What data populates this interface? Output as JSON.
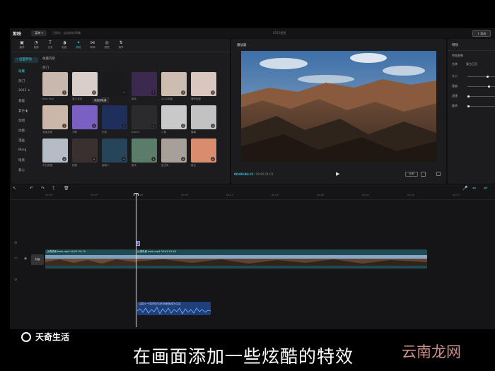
{
  "titlebar": {
    "app_name": "剪映",
    "menu": "菜单 ▾",
    "autosave": "已保存 · 自动保存草稿",
    "project_name": "0521视频",
    "export": "⇪ 导出"
  },
  "toolbar": [
    {
      "label": "媒体",
      "icon": "media-icon"
    },
    {
      "label": "音频",
      "icon": "audio-icon"
    },
    {
      "label": "文本",
      "icon": "text-icon"
    },
    {
      "label": "贴纸",
      "icon": "sticker-icon"
    },
    {
      "label": "特效",
      "icon": "effect-icon",
      "active": true
    },
    {
      "label": "转场",
      "icon": "transition-icon"
    },
    {
      "label": "滤镜",
      "icon": "filter-icon"
    },
    {
      "label": "调节",
      "icon": "adjust-icon"
    }
  ],
  "categories": [
    {
      "label": "• 画面特效",
      "first": true
    },
    {
      "label": "收藏",
      "active": true
    },
    {
      "label": "热门"
    },
    {
      "label": "2022 ✦"
    },
    {
      "label": "基础"
    },
    {
      "label": "复古 ▮"
    },
    {
      "label": "氛围"
    },
    {
      "label": "动感"
    },
    {
      "label": "漫画"
    },
    {
      "label": "Bling"
    },
    {
      "label": "暗黑"
    },
    {
      "label": "爱心"
    }
  ],
  "section_titles": {
    "favorites": "收藏内容",
    "hot": "热门"
  },
  "tooltip": "添加到轨道",
  "effects": [
    {
      "label": "New Year",
      "bg": "#c9b8ad"
    },
    {
      "label": "爱心泡泡",
      "bg": "#d9cfc8"
    },
    {
      "label": "变秋日",
      "bg": "#1a1a1c"
    },
    {
      "label": "新年",
      "bg": "#3c2a4e"
    },
    {
      "label": "2022祝福",
      "bg": "#cdbdb0"
    },
    {
      "label": "爆炸抱抱",
      "bg": "#d9c6bf"
    },
    {
      "label": "漫画恋爱",
      "bg": "#cbb7a9"
    },
    {
      "label": "冲刺",
      "bg": "#7b60c4"
    },
    {
      "label": "闪电",
      "bg": "#1d2f5a"
    },
    {
      "label": "DISCO",
      "bg": "#2b2b2e"
    },
    {
      "label": "人像",
      "bg": "#c9c9c9"
    },
    {
      "label": "模糊",
      "bg": "#c2c2c2"
    },
    {
      "label": "冬日氛围",
      "bg": "#b6bcc6"
    },
    {
      "label": "相框",
      "bg": "#3b3030"
    },
    {
      "label": "鱼眼 II",
      "bg": "#27455a"
    },
    {
      "label": "雾天",
      "bg": "#5c7c6a"
    },
    {
      "label": "复古风",
      "bg": "#a6a098"
    },
    {
      "label": "星空",
      "bg": "#d98c6e"
    }
  ],
  "player": {
    "title": "播放器",
    "time_current": "00:00:06:15",
    "time_total": "00:00:21:01",
    "play": "▶",
    "ratio": "比例"
  },
  "properties": {
    "title": "特效",
    "section": "特效参数",
    "rows": [
      {
        "label": "名称",
        "value": "复古日月"
      },
      {
        "label": "大小",
        "level": 0.7
      },
      {
        "label": "速度",
        "level": 0.75
      },
      {
        "label": "滤镜",
        "level": 0.0
      },
      {
        "label": "旋转",
        "level": 0.0
      }
    ]
  },
  "timeline": {
    "tools": [
      "↖",
      "↶",
      "↷",
      "⌶",
      "🗑"
    ],
    "ticks": [
      "00:00",
      "00:03",
      "00:06",
      "00:09",
      "00:12",
      "00:15",
      "00:18",
      "00:21",
      "00:24",
      "00:27"
    ],
    "cover": "封面",
    "marker": "复",
    "clips": [
      {
        "title": "沙漠风景 back.mp4   00:01:20:15",
        "color": "#1e4c52"
      },
      {
        "title": "沙漠风景 back.mp4   00:04:15:16",
        "color": "#1e4c52"
      }
    ],
    "audio": "以前片一样好的方法时间转换成为生活"
  },
  "overlay": {
    "watermark": "天奇生活",
    "subtitle": "在画面添加一些炫酷的特效",
    "site": "云南龙网"
  }
}
